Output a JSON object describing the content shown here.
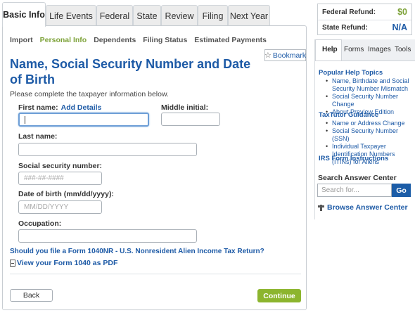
{
  "tabs": [
    {
      "label": "Basic Info",
      "active": true
    },
    {
      "label": "Life Events",
      "active": false
    },
    {
      "label": "Federal",
      "active": false
    },
    {
      "label": "State",
      "active": false
    },
    {
      "label": "Review",
      "active": false
    },
    {
      "label": "Filing",
      "active": false
    },
    {
      "label": "Next Year",
      "active": false
    }
  ],
  "subnav": [
    {
      "label": "Import",
      "active": false
    },
    {
      "label": "Personal Info",
      "active": true
    },
    {
      "label": "Dependents",
      "active": false
    },
    {
      "label": "Filing Status",
      "active": false
    },
    {
      "label": "Estimated Payments",
      "active": false
    }
  ],
  "bookmark_label": "Bookmark",
  "page_title": "Name, Social Security Number and Date of Birth",
  "intro": "Please complete the taxpayer information below.",
  "form": {
    "first_name_label": "First name:",
    "add_details_link": "Add Details",
    "first_name_value": "",
    "middle_initial_label": "Middle initial:",
    "middle_initial_value": "",
    "last_name_label": "Last name:",
    "last_name_value": "",
    "ssn_label": "Social security number:",
    "ssn_placeholder": "###-##-####",
    "dob_label": "Date of birth (mm/dd/yyyy):",
    "dob_placeholder": "MM/DD/YYYY",
    "occupation_label": "Occupation:",
    "occupation_value": ""
  },
  "nonresident_link": "Should you file a Form 1040NR - U.S. Nonresident Alien Income Tax Return?",
  "pdf_link": "View your Form 1040 as PDF",
  "back_label": "Back",
  "continue_label": "Continue",
  "refund": {
    "federal_label": "Federal Refund:",
    "federal_value": "$0",
    "federal_color": "#7ea33a",
    "state_label": "State Refund:",
    "state_value": "N/A",
    "state_color": "#1d5aa6"
  },
  "help": {
    "tabs": [
      {
        "label": "Help",
        "active": true
      },
      {
        "label": "Forms",
        "active": false
      },
      {
        "label": "Images",
        "active": false
      },
      {
        "label": "Tools",
        "active": false
      }
    ],
    "popular_title": "Popular Help Topics",
    "popular_items": [
      "Name, Birthdate and Social Security Number Mismatch",
      "Social Security Number Change",
      "About Preview Edition"
    ],
    "tutor_title": "TaxTutor Guidance",
    "tutor_items": [
      "Name or Address Change",
      "Social Security Number (SSN)",
      "Individual Taxpayer Identification Numbers (ITINs) for Aliens"
    ],
    "irs_link": "IRS Form Instructions"
  },
  "search": {
    "title": "Search Answer Center",
    "placeholder": "Search for...",
    "button": "Go",
    "browse_label": "Browse Answer Center"
  }
}
